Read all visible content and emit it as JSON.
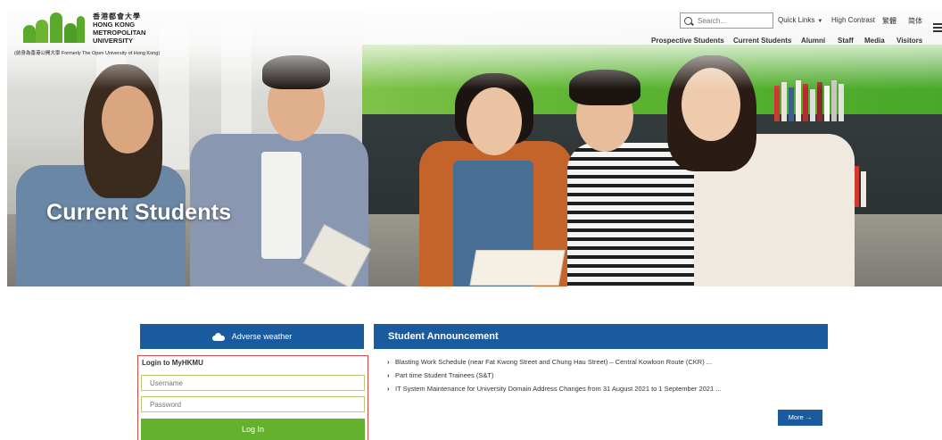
{
  "header": {
    "logo": {
      "zh_name": "香港都會大學",
      "en_line1": "HONG KONG",
      "en_line2": "METROPOLITAN",
      "en_line3": "UNIVERSITY",
      "former_name": "(前身為香港公開大學 Formerly The Open University of Hong Kong)"
    },
    "search": {
      "placeholder": "Search..."
    },
    "utility_links": {
      "quick_links": "Quick Links",
      "high_contrast": "High Contrast",
      "traditional": "繁體",
      "simplified": "简体"
    },
    "nav": [
      "Prospective Students",
      "Current Students",
      "Alumni",
      "Staff",
      "Media",
      "Visitors"
    ]
  },
  "hero": {
    "title": "Current Students"
  },
  "weather": {
    "label": "Adverse weather"
  },
  "login": {
    "title": "Login to MyHKMU",
    "username_placeholder": "Username",
    "password_placeholder": "Password",
    "button": "Log In"
  },
  "announcements": {
    "title": "Student Announcement",
    "items": [
      "Blasting Work Schedule (near Fat Kwong Street and Chung Hau Street) – Central Kowloon Route (CKR) ...",
      "Part time Student Trainees (S&T)",
      "IT System Maintenance for University Domain Address Changes from 31 August 2021 to 1 September 2021 ..."
    ],
    "more": "More"
  },
  "colors": {
    "brand_green": "#5aa92b",
    "brand_blue": "#1a5a9f",
    "login_border": "#d24a4a",
    "login_button": "#64b12d"
  }
}
